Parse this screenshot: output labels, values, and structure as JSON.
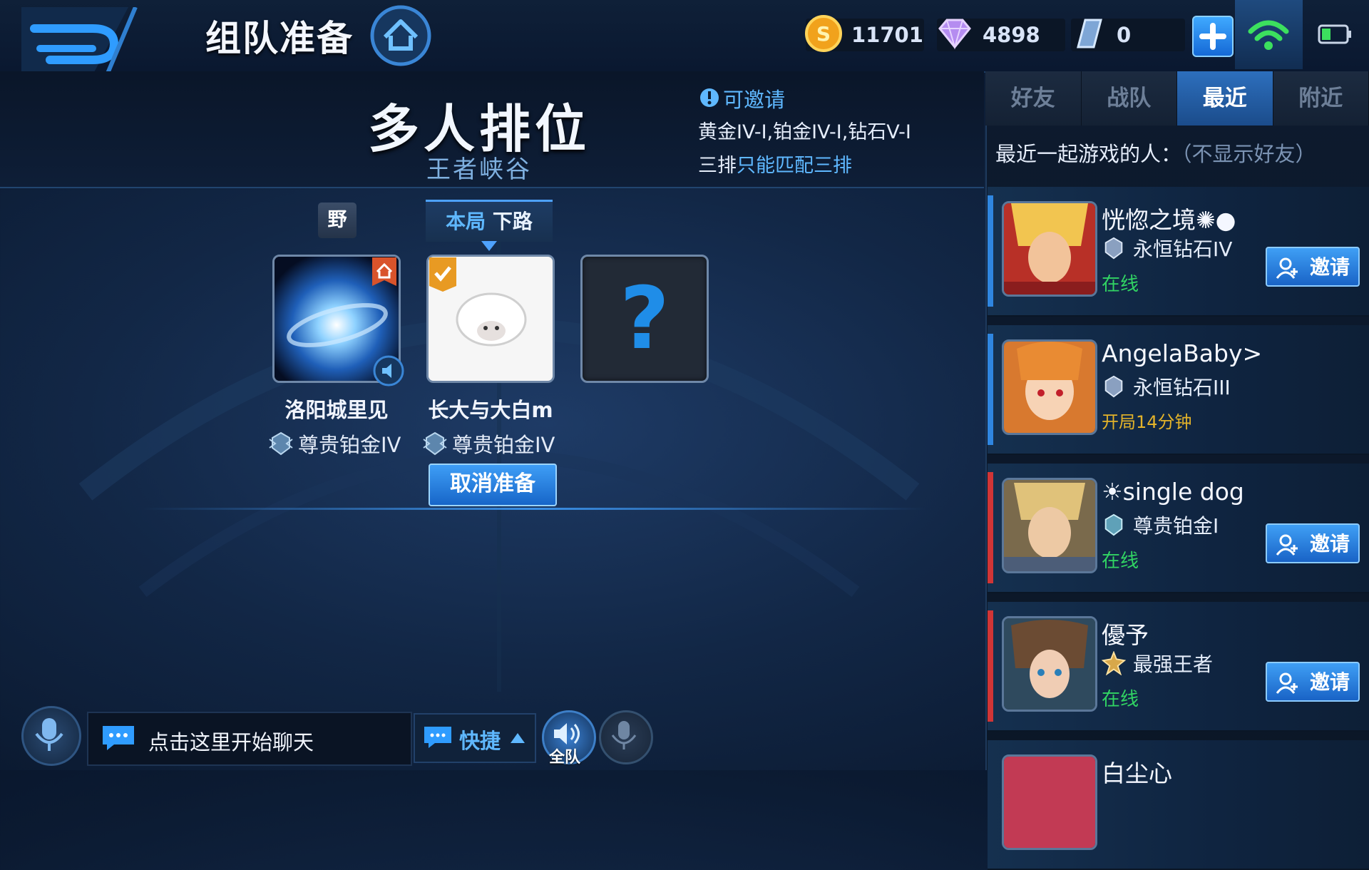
{
  "header": {
    "title": "组队准备",
    "resources": {
      "gold": "11701",
      "gems": "4898",
      "vouchers": "0"
    }
  },
  "mode": {
    "title": "多人排位",
    "subtitle": "王者峡谷",
    "invite_title": "可邀请",
    "rank_range": "黄金IV-I,铂金IV-I,钻石V-I",
    "rule_prefix": "三排",
    "rule_highlight": "只能匹配三排"
  },
  "lanes": {
    "slot1_tag": "野",
    "current_prefix": "本局",
    "current_lane": "下路"
  },
  "players": [
    {
      "name": "洛阳城里见",
      "rank": "尊贵铂金IV"
    },
    {
      "name": "长大与大白m",
      "rank": "尊贵铂金IV"
    }
  ],
  "empty_slot_glyph": "?",
  "actions": {
    "cancel_ready": "取消准备"
  },
  "chat": {
    "placeholder": "点击这里开始聊天",
    "quick_label": "快捷",
    "team_voice_label": "全队"
  },
  "side": {
    "tabs": [
      "好友",
      "战队",
      "最近",
      "附近"
    ],
    "active_tab": "最近",
    "recent_title": "最近一起游戏的人：",
    "recent_note": "（不显示好友）",
    "invite_label": "邀请",
    "friends": [
      {
        "name": "恍惚之境✺●",
        "rank": "永恒钻石IV",
        "status": "在线"
      },
      {
        "name": "AngelaBaby>",
        "rank": "永恒钻石III",
        "status": "开局14分钟"
      },
      {
        "name": "☀single dog",
        "rank": "尊贵铂金I",
        "status": "在线"
      },
      {
        "name": "優予",
        "rank": "最强王者",
        "status": "在线"
      },
      {
        "name": "白尘心",
        "rank": "",
        "status": ""
      }
    ]
  },
  "colors": {
    "accent": "#5fb8ff",
    "online": "#31d463",
    "playing": "#e3b32a",
    "button": "#1f7be0"
  }
}
